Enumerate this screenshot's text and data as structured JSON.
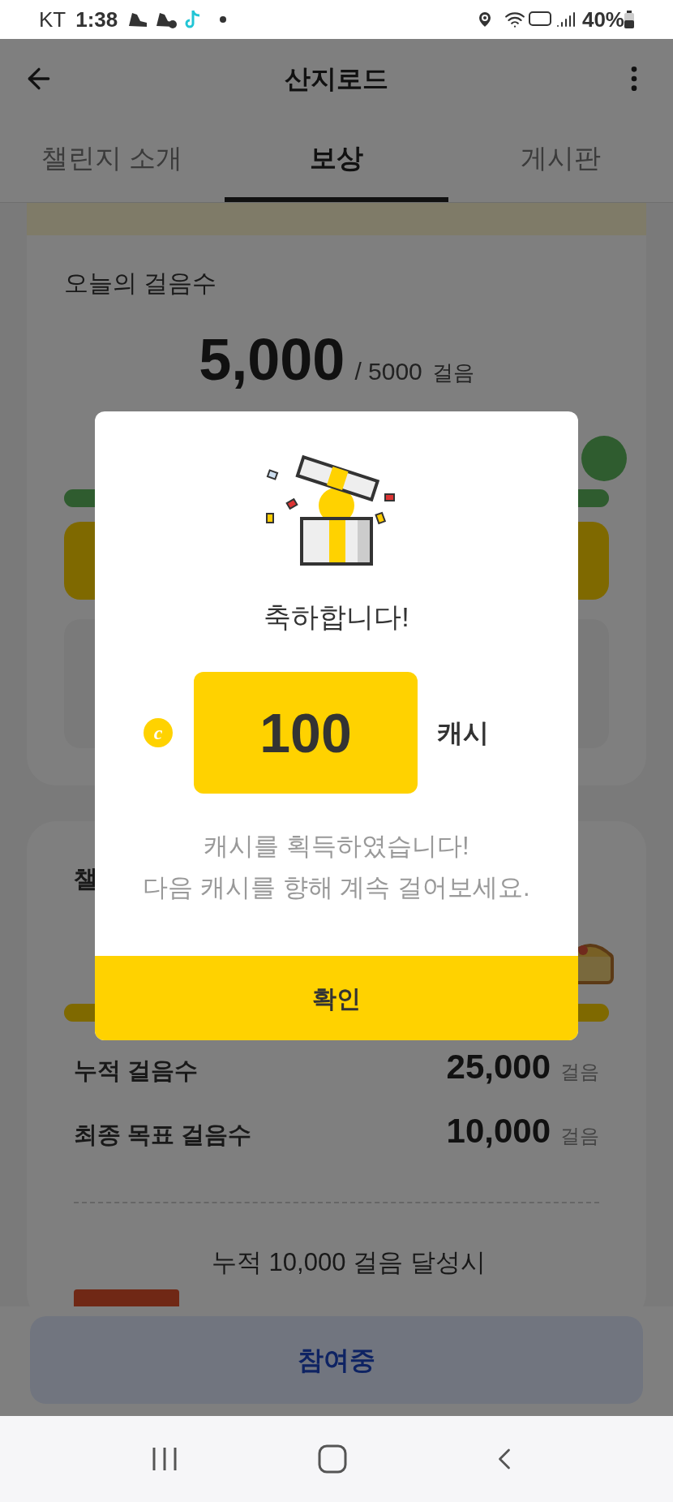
{
  "status_bar": {
    "carrier": "KT",
    "time": "1:38",
    "battery": "40%"
  },
  "header": {
    "title": "산지로드"
  },
  "tabs": [
    {
      "label": "챌린지 소개",
      "selected": false
    },
    {
      "label": "보상",
      "selected": true
    },
    {
      "label": "게시판",
      "selected": false
    }
  ],
  "today": {
    "title": "오늘의 걸음수",
    "steps": "5,000",
    "goal": "/ 5000",
    "unit": "걸음",
    "level": 1
  },
  "challenge": {
    "title_fragment": "챌",
    "level": 1,
    "rows": [
      {
        "label": "누적 걸음수",
        "value": "25,000",
        "unit": "걸음"
      },
      {
        "label": "최종 목표 걸음수",
        "value": "10,000",
        "unit": "걸음"
      }
    ],
    "reward": "누적 10,000 걸음 달성시"
  },
  "bottom_button": "참여중",
  "modal": {
    "title": "축하합니다!",
    "amount": "100",
    "currency": "캐시",
    "coin": "c",
    "message": [
      "캐시를 획득하였습니다!",
      "다음 캐시를 향해 계속 걸어보세요."
    ],
    "confirm": "확인"
  }
}
